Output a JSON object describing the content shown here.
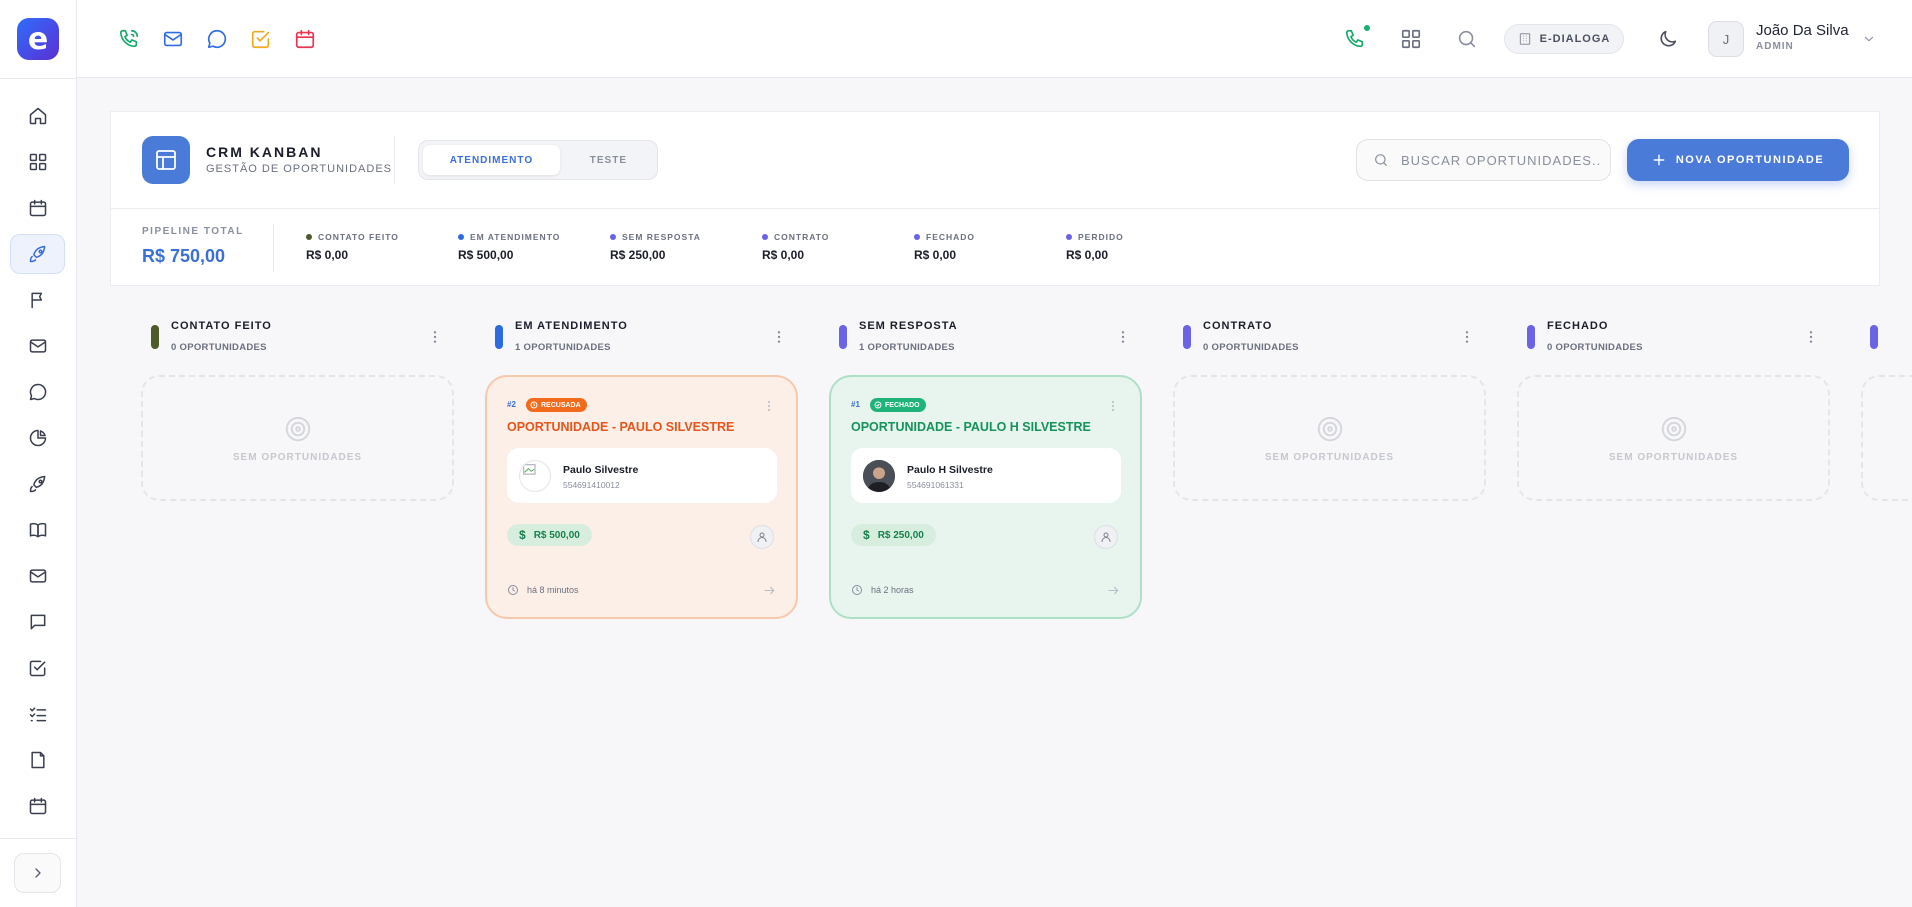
{
  "app": {
    "logo_letter": "e"
  },
  "header": {
    "workspace": "E-DIALOGA",
    "user": {
      "initial": "J",
      "name": "João Da Silva",
      "role": "ADMIN"
    },
    "icons": [
      "phone-icon",
      "mail-icon",
      "chat-icon",
      "task-icon",
      "calendar-icon",
      "call-status-icon",
      "apps-grid-icon",
      "search-icon",
      "moon-icon"
    ]
  },
  "sidebar": {
    "items": [
      "home-icon",
      "dashboard-icon",
      "calendar-icon",
      "rocket-icon",
      "flag-icon",
      "mail-icon",
      "chat-icon",
      "pie-chart-icon",
      "rocket-icon",
      "book-icon",
      "mail-icon",
      "message-square-icon",
      "checkbox-icon",
      "list-check-icon",
      "file-icon",
      "calendar-icon"
    ],
    "active_index": 3
  },
  "page": {
    "title": "CRM KANBAN",
    "subtitle": "GESTÃO DE OPORTUNIDADES",
    "tabs": [
      {
        "label": "ATENDIMENTO",
        "active": true
      },
      {
        "label": "TESTE",
        "active": false
      }
    ],
    "search_placeholder": "BUSCAR OPORTUNIDADES...",
    "new_button_label": "NOVA OPORTUNIDADE"
  },
  "summary": {
    "pipeline_label": "PIPELINE TOTAL",
    "pipeline_total": "R$ 750,00",
    "stages": [
      {
        "label": "CONTATO FEITO",
        "value": "R$ 0,00",
        "color": "#4d5a2a"
      },
      {
        "label": "EM ATENDIMENTO",
        "value": "R$ 500,00",
        "color": "#2b6ae0"
      },
      {
        "label": "SEM RESPOSTA",
        "value": "R$ 250,00",
        "color": "#6b63e6"
      },
      {
        "label": "CONTRATO",
        "value": "R$ 0,00",
        "color": "#6b63e6"
      },
      {
        "label": "FECHADO",
        "value": "R$ 0,00",
        "color": "#6b63e6"
      },
      {
        "label": "PERDIDO",
        "value": "R$ 0,00",
        "color": "#6b63e6"
      }
    ]
  },
  "board": {
    "empty_text": "SEM OPORTUNIDADES",
    "columns": [
      {
        "title": "CONTATO FEITO",
        "count": "0 OPORTUNIDADES",
        "color": "#4d5a2a"
      },
      {
        "title": "EM ATENDIMENTO",
        "count": "1 OPORTUNIDADES",
        "color": "#2b6ae0"
      },
      {
        "title": "SEM RESPOSTA",
        "count": "1 OPORTUNIDADES",
        "color": "#6b63e6"
      },
      {
        "title": "CONTRATO",
        "count": "0 OPORTUNIDADES",
        "color": "#6b63e6"
      },
      {
        "title": "FECHADO",
        "count": "0 OPORTUNIDADES",
        "color": "#6b63e6"
      }
    ],
    "cards": [
      {
        "number": "#2",
        "badge": "RECUSADA",
        "badge_color": "#f26b1d",
        "title": "OPORTUNIDADE - PAULO SILVESTRE",
        "title_color": "#e8541a",
        "contact_name": "Paulo Silvestre",
        "contact_phone": "554691410012",
        "value": "R$ 500,00",
        "time": "há 8 minutos"
      },
      {
        "number": "#1",
        "badge": "FECHADO",
        "badge_color": "#1fb37a",
        "title": "OPORTUNIDADE - PAULO H SILVESTRE",
        "title_color": "#14935a",
        "contact_name": "Paulo H Silvestre",
        "contact_phone": "554691061331",
        "value": "R$ 250,00",
        "time": "há 2 horas"
      }
    ]
  }
}
